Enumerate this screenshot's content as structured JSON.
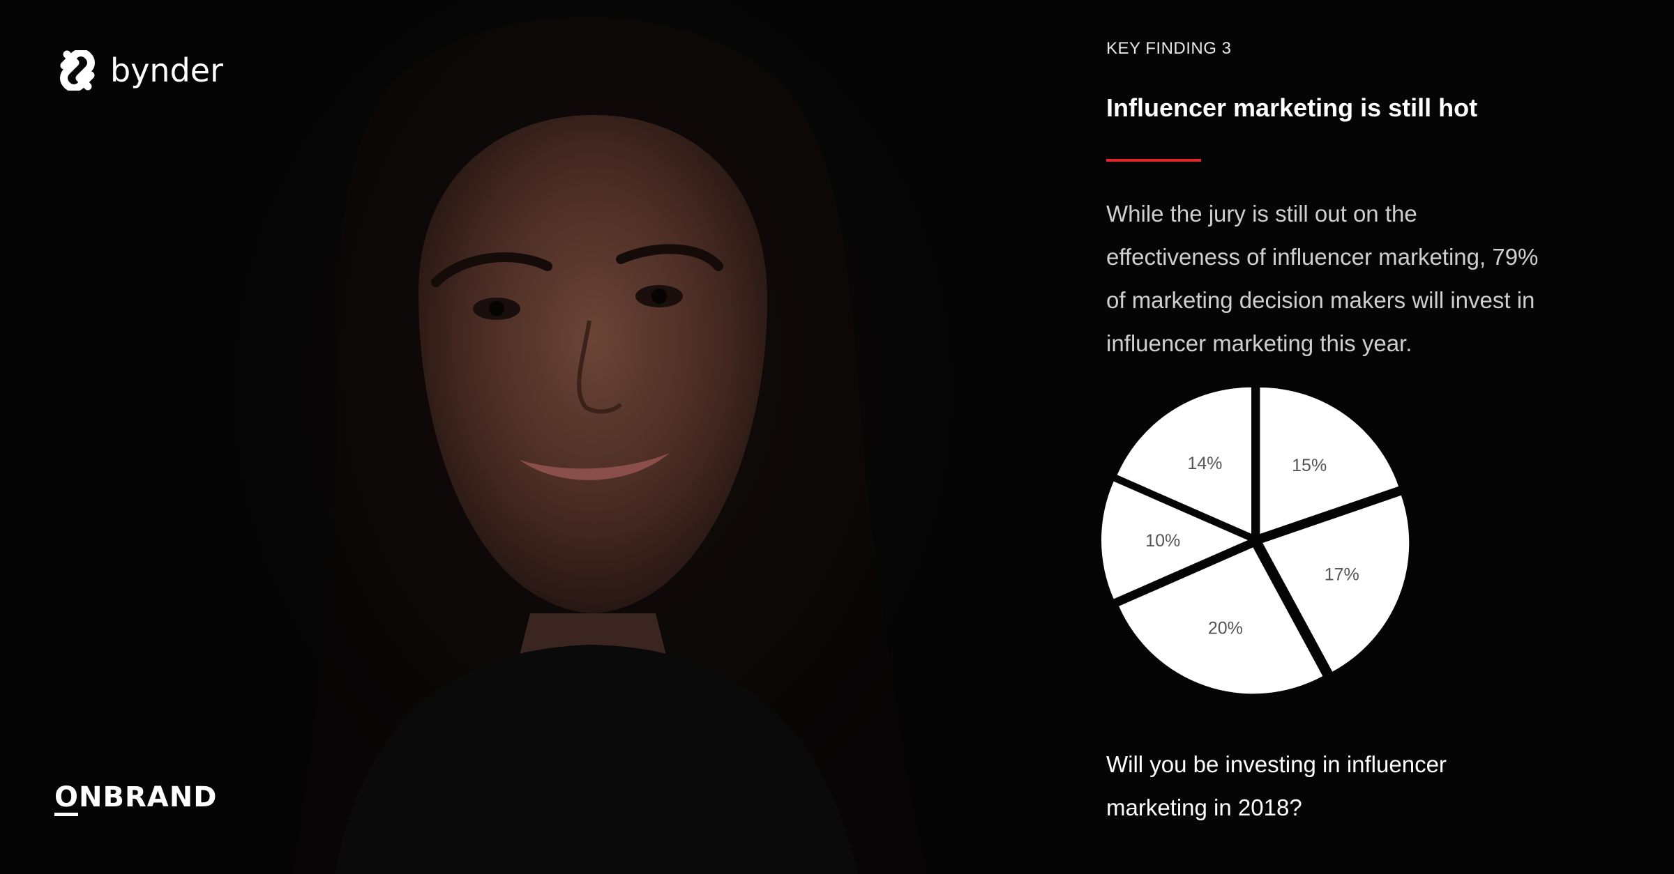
{
  "brand": {
    "name": "bynder",
    "logo_icon": "bynder-mark-icon",
    "footer_logo": "ONBRAND"
  },
  "panel": {
    "kicker": "KEY FINDING 3",
    "heading": "Influencer marketing is still hot",
    "body": "While the jury is still out on the effectiveness of influencer marketing, 79% of marketing decision makers will invest in influencer marketing this year.",
    "question": "Will you be investing in influencer marketing in 2018?"
  },
  "colors": {
    "background": "#050505",
    "accent": "#e0262b",
    "slice": "#ffffff",
    "label": "#555555"
  },
  "chart_data": {
    "type": "pie",
    "title": "",
    "slices": [
      {
        "label": "15%",
        "value": 15
      },
      {
        "label": "17%",
        "value": 17
      },
      {
        "label": "20%",
        "value": 20
      },
      {
        "label": "10%",
        "value": 10
      },
      {
        "label": "14%",
        "value": 14
      }
    ],
    "legend": "none"
  }
}
